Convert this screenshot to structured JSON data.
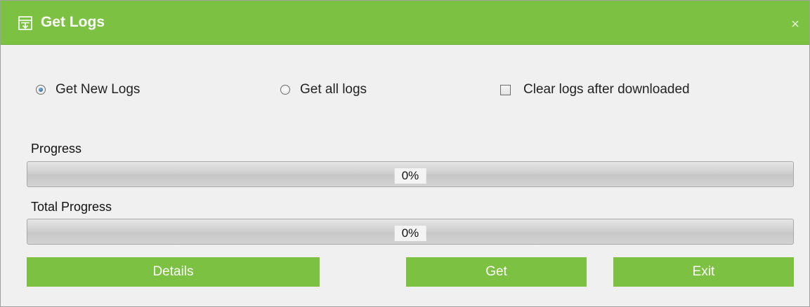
{
  "window": {
    "title": "Get Logs",
    "icon": "logs-icon",
    "close_icon": "close-icon"
  },
  "options": {
    "get_new_logs": {
      "label": "Get New Logs",
      "selected": true
    },
    "get_all_logs": {
      "label": "Get all logs",
      "selected": false
    },
    "clear_logs_after_download": {
      "label": "Clear logs after downloaded",
      "checked": false
    }
  },
  "progress": {
    "label": "Progress",
    "value_text": "0%",
    "value": 0
  },
  "total_progress": {
    "label": "Total Progress",
    "value_text": "0%",
    "value": 0
  },
  "buttons": {
    "details": "Details",
    "get": "Get",
    "exit": "Exit"
  },
  "colors": {
    "accent": "#7cc142",
    "button_text": "#ffffff",
    "dialog_background": "#f0f0f0"
  }
}
